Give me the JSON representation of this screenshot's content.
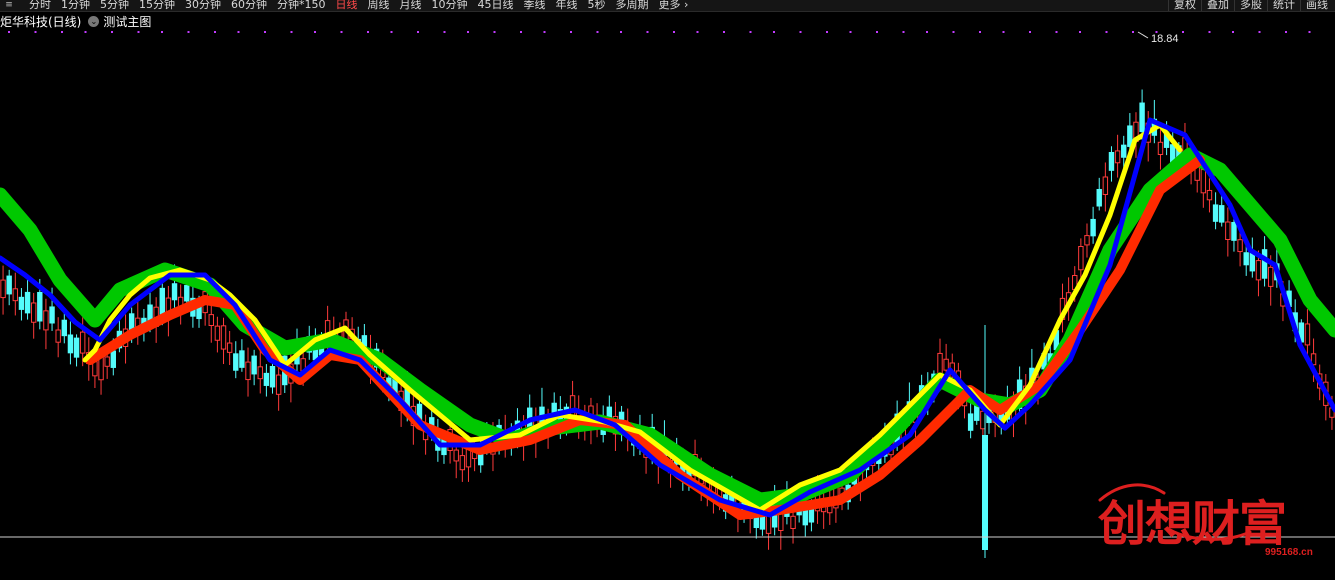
{
  "toolbar": {
    "menu_icon": "menu-icon",
    "tabs": [
      {
        "label": "分时",
        "active": false
      },
      {
        "label": "1分钟",
        "active": false
      },
      {
        "label": "5分钟",
        "active": false
      },
      {
        "label": "15分钟",
        "active": false
      },
      {
        "label": "30分钟",
        "active": false
      },
      {
        "label": "60分钟",
        "active": false
      },
      {
        "label": "分钟*150",
        "active": false
      },
      {
        "label": "日线",
        "active": true
      },
      {
        "label": "周线",
        "active": false
      },
      {
        "label": "月线",
        "active": false
      },
      {
        "label": "10分钟",
        "active": false
      },
      {
        "label": "45日线",
        "active": false
      },
      {
        "label": "季线",
        "active": false
      },
      {
        "label": "年线",
        "active": false
      },
      {
        "label": "5秒",
        "active": false
      },
      {
        "label": "多周期",
        "active": false
      },
      {
        "label": "更多",
        "active": false
      }
    ],
    "more_icon": "chevron-right-icon",
    "right_buttons": [
      "复权",
      "叠加",
      "多股",
      "统计",
      "画线"
    ]
  },
  "subbar": {
    "stock_title": "炬华科技(日线)",
    "indicator_label": "测试主图",
    "dropdown_icon": "chevron-down-icon"
  },
  "chart": {
    "bg_color": "#000000",
    "up_color": "#ff3b3b",
    "down_color": "#54fcfc",
    "watermark": {
      "text": "创想财富",
      "site": "995168.cn",
      "color": "#dd1f1f"
    },
    "max_label": "18.84",
    "candle_count": 218,
    "reference_level": 1.0
  },
  "chart_data": {
    "type": "candlestick-with-bands",
    "series": [
      {
        "name": "",
        "values": []
      }
    ]
  }
}
